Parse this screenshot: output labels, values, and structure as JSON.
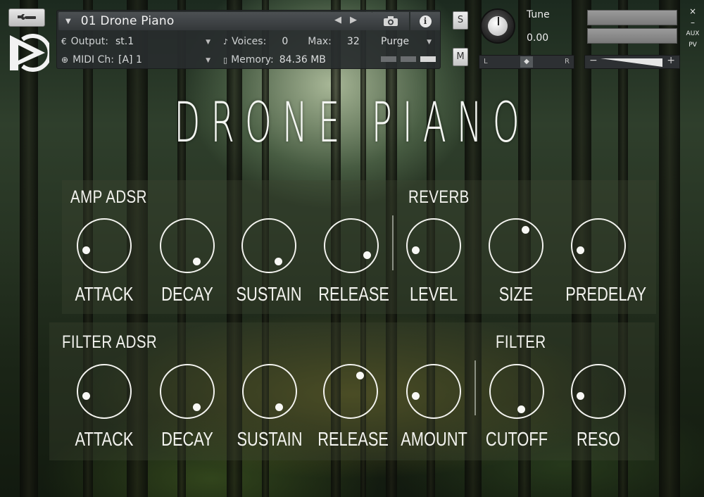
{
  "header": {
    "instrument_name": "01 Drone Piano",
    "output_label": "Output:",
    "output_value": "st.1",
    "voices_label": "Voices:",
    "voices_value": "0",
    "max_label": "Max:",
    "max_value": "32",
    "purge_label": "Purge",
    "midi_label": "MIDI Ch:",
    "midi_value": "[A]  1",
    "memory_label": "Memory:",
    "memory_value": "84.36 MB",
    "solo_label": "S",
    "mute_label": "M",
    "tune_label": "Tune",
    "tune_value": "0.00",
    "pan_left": "L",
    "pan_right": "R",
    "vol_minus": "−",
    "vol_plus": "+",
    "aux_label": "AUX",
    "pv_label": "PV",
    "close_label": "×",
    "minimize_label": "–"
  },
  "title": "DRONE PIANO",
  "amp_adsr": {
    "label": "AMP ADSR",
    "knobs": [
      {
        "label": "ATTACK",
        "value": 0.05
      },
      {
        "label": "DECAY",
        "value": 0.9
      },
      {
        "label": "SUSTAIN",
        "value": 0.9
      },
      {
        "label": "RELEASE",
        "value": 0.8
      }
    ]
  },
  "reverb": {
    "label": "REVERB",
    "knobs": [
      {
        "label": "LEVEL",
        "value": 0.05
      },
      {
        "label": "SIZE",
        "value": 0.5
      },
      {
        "label": "PREDELAY",
        "value": 0.05
      }
    ]
  },
  "filter_adsr": {
    "label": "FILTER ADSR",
    "knobs": [
      {
        "label": "ATTACK",
        "value": 0.05
      },
      {
        "label": "DECAY",
        "value": 0.9
      },
      {
        "label": "SUSTAIN",
        "value": 0.9
      },
      {
        "label": "RELEASE",
        "value": 0.5
      },
      {
        "label": "AMOUNT",
        "value": 0.05
      }
    ]
  },
  "filter": {
    "label": "FILTER",
    "knobs": [
      {
        "label": "CUTOFF",
        "value": 0.95
      },
      {
        "label": "RESO",
        "value": 0.05
      }
    ]
  }
}
